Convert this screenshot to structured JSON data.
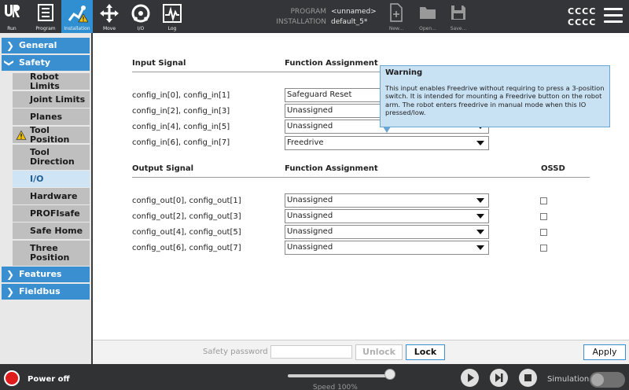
{
  "topbar": {
    "nav": [
      {
        "label": "Run",
        "icon": "ur-logo-icon"
      },
      {
        "label": "Program",
        "icon": "program-icon"
      },
      {
        "label": "Installation",
        "icon": "installation-icon",
        "active": true
      },
      {
        "label": "Move",
        "icon": "move-icon"
      },
      {
        "label": "I/O",
        "icon": "io-icon"
      },
      {
        "label": "Log",
        "icon": "log-icon"
      }
    ],
    "program_key": "PROGRAM",
    "program_value": "<unnamed>",
    "installation_key": "INSTALLATION",
    "installation_value": "default_5*",
    "file_buttons": [
      {
        "label": "New...",
        "icon": "new-file-icon"
      },
      {
        "label": "Open...",
        "icon": "folder-icon"
      },
      {
        "label": "Save...",
        "icon": "save-icon"
      }
    ],
    "robot_name_line1": "CCCC",
    "robot_name_line2": "CCCC",
    "menu_icon": "hamburger-menu-icon"
  },
  "sidebar": {
    "groups": [
      {
        "label": "General",
        "expanded": false
      },
      {
        "label": "Safety",
        "expanded": true
      },
      {
        "label": "Features",
        "expanded": false
      },
      {
        "label": "Fieldbus",
        "expanded": false
      }
    ],
    "safety_items": [
      {
        "label": "Robot Limits"
      },
      {
        "label": "Joint Limits"
      },
      {
        "label": "Planes"
      },
      {
        "label": "Tool Position",
        "warning": true
      },
      {
        "label": "Tool\nDirection"
      },
      {
        "label": "I/O",
        "selected": true
      },
      {
        "label": "Hardware"
      },
      {
        "label": "PROFIsafe"
      },
      {
        "label": "Safe Home"
      },
      {
        "label": "Three\nPosition"
      }
    ]
  },
  "inputs": {
    "header_signal": "Input Signal",
    "header_function": "Function Assignment",
    "rows": [
      {
        "signal": "config_in[0], config_in[1]",
        "function": "Safeguard Reset"
      },
      {
        "signal": "config_in[2], config_in[3]",
        "function": "Unassigned"
      },
      {
        "signal": "config_in[4], config_in[5]",
        "function": "Unassigned"
      },
      {
        "signal": "config_in[6], config_in[7]",
        "function": "Freedrive"
      }
    ]
  },
  "outputs": {
    "header_signal": "Output Signal",
    "header_function": "Function Assignment",
    "header_ossd": "OSSD",
    "rows": [
      {
        "signal": "config_out[0], config_out[1]",
        "function": "Unassigned",
        "ossd": false
      },
      {
        "signal": "config_out[2], config_out[3]",
        "function": "Unassigned",
        "ossd": false
      },
      {
        "signal": "config_out[4], config_out[5]",
        "function": "Unassigned",
        "ossd": false
      },
      {
        "signal": "config_out[6], config_out[7]",
        "function": "Unassigned",
        "ossd": false
      }
    ]
  },
  "tooltip": {
    "title": "Warning",
    "body": "This input enables Freedrive without requiring to press a 3-position switch. It is intended for mounting a Freedrive button on the robot arm. The robot enters freedrive in manual mode when this IO pressed/low."
  },
  "lockbar": {
    "password_label": "Safety password",
    "password_value": "",
    "unlock_label": "Unlock",
    "lock_label": "Lock",
    "apply_label": "Apply"
  },
  "statusbar": {
    "power_label": "Power off",
    "speed_label": "Speed 100%",
    "speed_percent": 100,
    "simulation_label": "Simulation",
    "simulation_on": false
  }
}
